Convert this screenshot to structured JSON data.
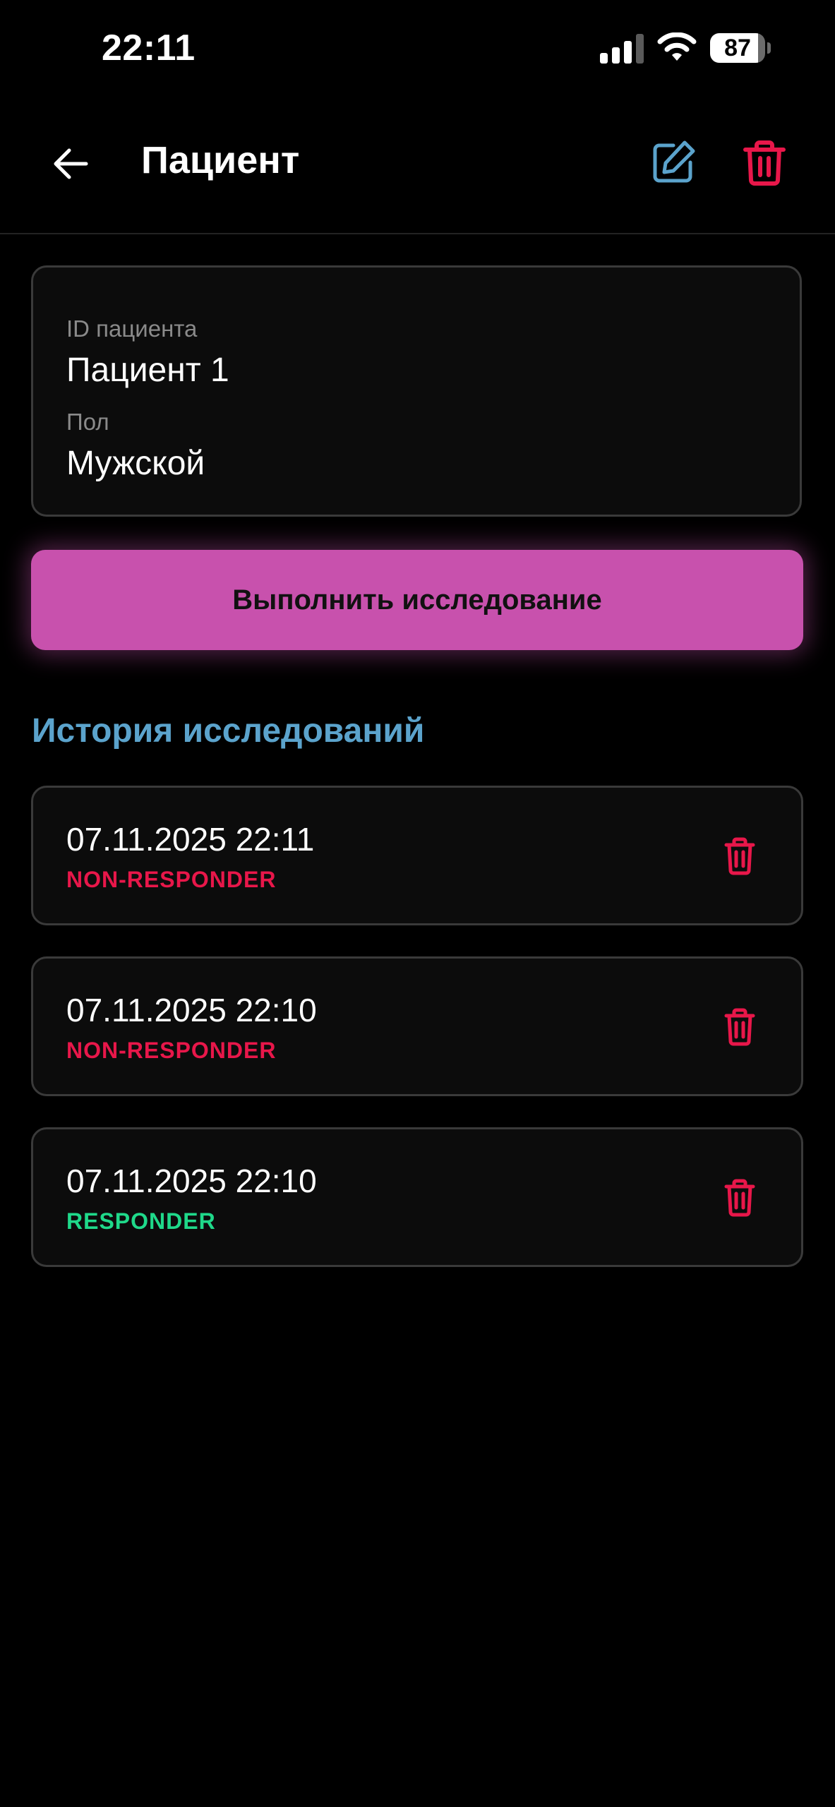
{
  "status_bar": {
    "time": "22:11",
    "battery_level": "87",
    "icons": [
      "cellular-signal-icon",
      "wifi-icon",
      "battery-icon"
    ]
  },
  "header": {
    "title": "Пациент",
    "icons": [
      "back-arrow-icon",
      "edit-icon",
      "trash-icon"
    ]
  },
  "patient": {
    "id_label": "ID пациента",
    "id_value": "Пациент 1",
    "sex_label": "Пол",
    "sex_value": "Мужской"
  },
  "actions": {
    "run_study_label": "Выполнить исследование"
  },
  "history": {
    "title": "История исследований",
    "items": [
      {
        "datetime": "07.11.2025 22:11",
        "result": "NON-RESPONDER"
      },
      {
        "datetime": "07.11.2025 22:10",
        "result": "NON-RESPONDER"
      },
      {
        "datetime": "07.11.2025 22:10",
        "result": "RESPONDER"
      }
    ]
  },
  "colors": {
    "background": "#000000",
    "card_background": "#0c0c0c",
    "card_border": "#3a3a3a",
    "accent_pink": "#c851ad",
    "accent_blue": "#5ba3cc",
    "danger_red": "#e8174a",
    "success_green": "#1fd98a",
    "label_gray": "#8a8a8a"
  }
}
